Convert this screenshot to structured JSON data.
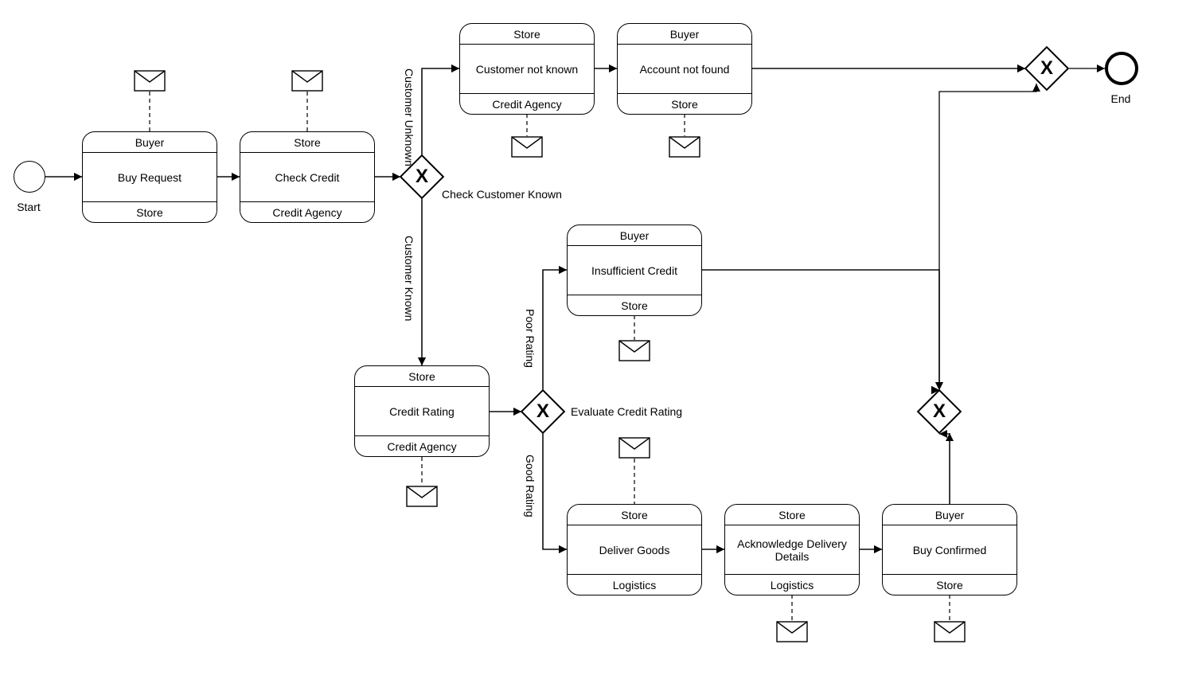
{
  "labels": {
    "start": "Start",
    "end": "End",
    "checkCustomerKnown": "Check Customer Known",
    "customerUnknown": "Customer Unknown",
    "customerKnown": "Customer Known",
    "evaluateCreditRating": "Evaluate Credit Rating",
    "poorRating": "Poor Rating",
    "goodRating": "Good Rating"
  },
  "tasks": {
    "buyRequest": {
      "top": "Buyer",
      "mid": "Buy Request",
      "bot": "Store"
    },
    "checkCredit": {
      "top": "Store",
      "mid": "Check Credit",
      "bot": "Credit Agency"
    },
    "customerNotKnown": {
      "top": "Store",
      "mid": "Customer not known",
      "bot": "Credit Agency"
    },
    "accountNotFound": {
      "top": "Buyer",
      "mid": "Account not found",
      "bot": "Store"
    },
    "creditRating": {
      "top": "Store",
      "mid": "Credit Rating",
      "bot": "Credit Agency"
    },
    "insufficient": {
      "top": "Buyer",
      "mid": "Insufficient Credit",
      "bot": "Store"
    },
    "deliverGoods": {
      "top": "Store",
      "mid": "Deliver Goods",
      "bot": "Logistics"
    },
    "ackDelivery": {
      "top": "Store",
      "mid": "Acknowledge Delivery Details",
      "bot": "Logistics"
    },
    "buyConfirmed": {
      "top": "Buyer",
      "mid": "Buy Confirmed",
      "bot": "Store"
    }
  }
}
